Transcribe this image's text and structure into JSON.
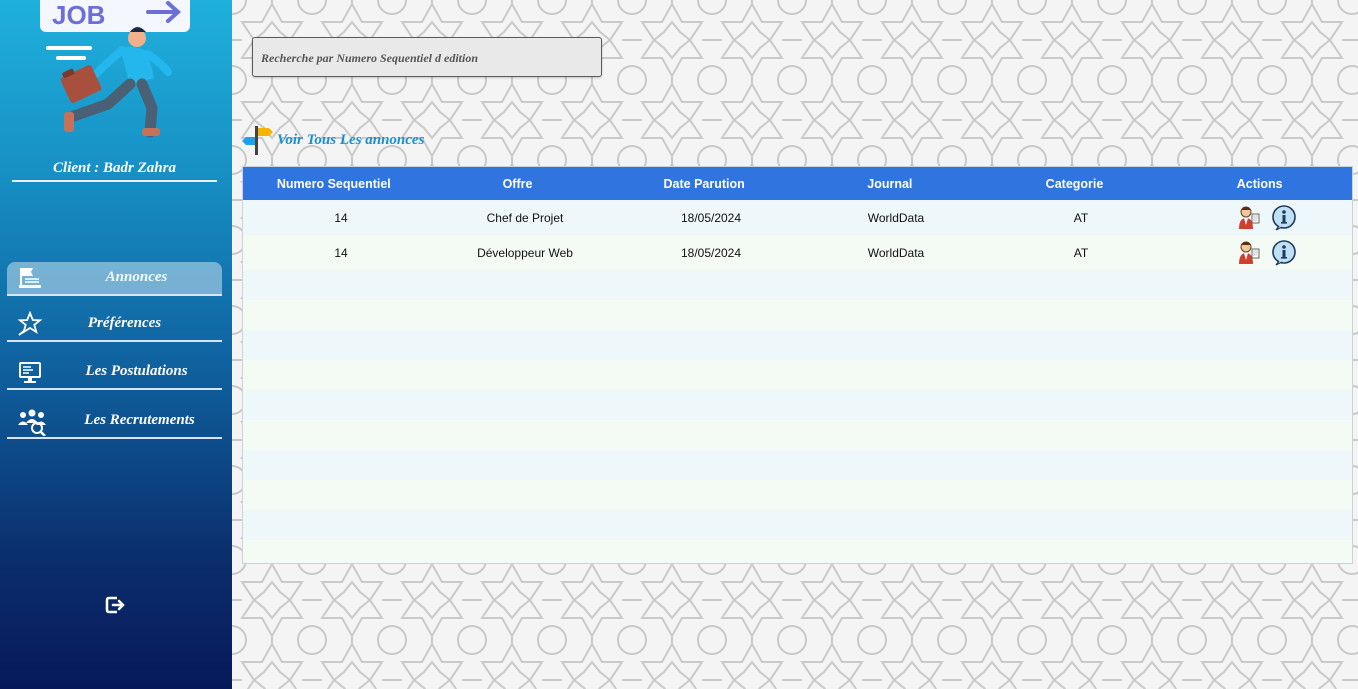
{
  "sidebar": {
    "logo_text": "JOB",
    "client_label": "Client : Badr Zahra",
    "items": [
      {
        "label": "Annonces",
        "icon": "announcement-board-icon",
        "active": true
      },
      {
        "label": "Préférences",
        "icon": "star-hand-icon",
        "active": false
      },
      {
        "label": "Les Postulations",
        "icon": "desktop-computer-icon",
        "active": false
      },
      {
        "label": "Les Recrutements",
        "icon": "group-search-icon",
        "active": false
      }
    ],
    "logout_icon": "logout-icon"
  },
  "search": {
    "placeholder": "Recherche par Numero Sequentiel d edition",
    "value": ""
  },
  "view_all": {
    "label": "Voir Tous Les annonces",
    "icon": "signpost-icon"
  },
  "table": {
    "columns": [
      "Numero Sequentiel",
      "Offre",
      "Date Parution",
      "Journal",
      "Categorie",
      "Actions"
    ],
    "rows": [
      {
        "numero": "14",
        "offre": "Chef de Projet",
        "date": "18/05/2024",
        "journal": "WorldData",
        "categorie": "AT"
      },
      {
        "numero": "14",
        "offre": "Développeur Web",
        "date": "18/05/2024",
        "journal": "WorldData",
        "categorie": "AT"
      }
    ],
    "action_icons": [
      "apply-person-icon",
      "info-icon"
    ]
  },
  "colors": {
    "header_bg": "#3074e0",
    "accent_link": "#1a90cf",
    "sidebar_top": "#1fb0dd",
    "sidebar_bottom": "#08195a"
  }
}
